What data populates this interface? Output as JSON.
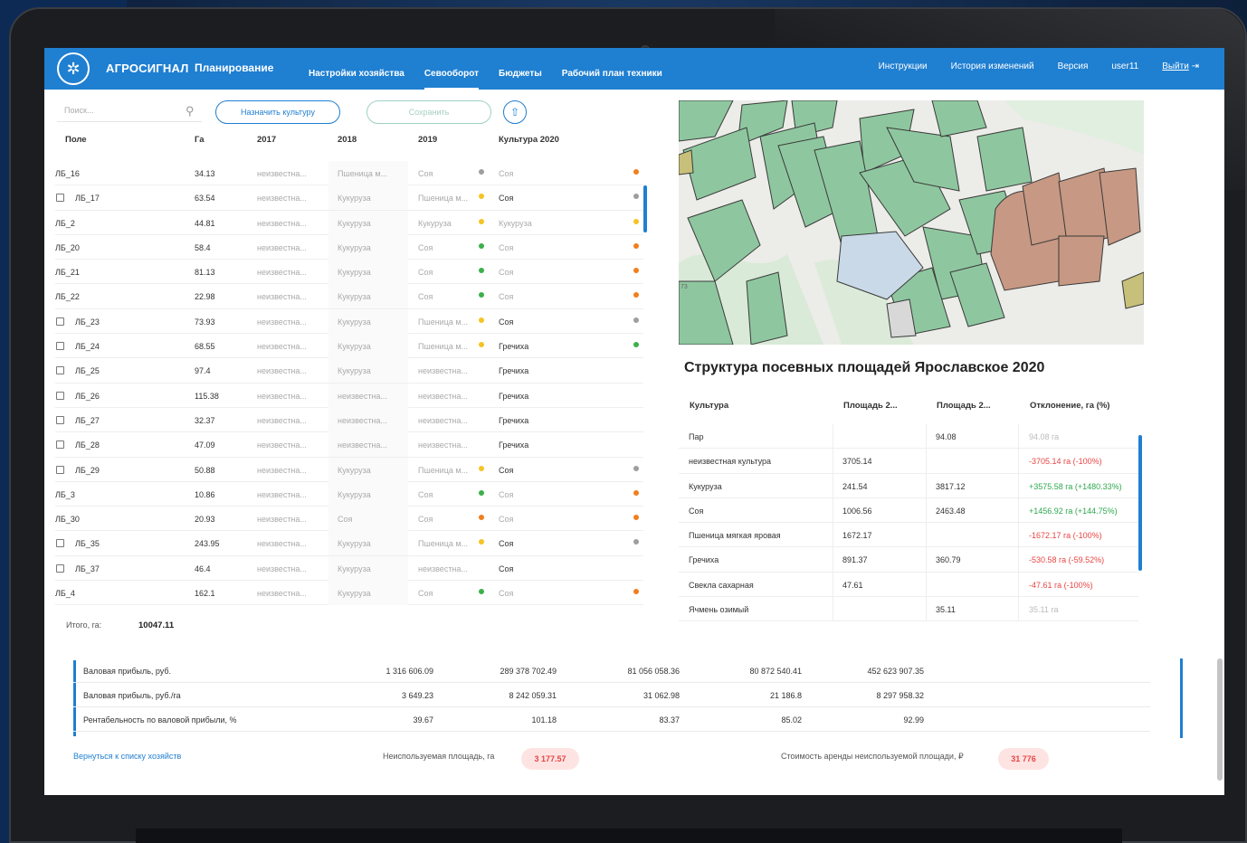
{
  "header": {
    "brand": "АГРОСИГНАЛ",
    "module": "Планирование",
    "tabs": [
      {
        "label": "Настройки хозяйства"
      },
      {
        "label": "Севооборот"
      },
      {
        "label": "Бюджеты"
      },
      {
        "label": "Рабочий план техники"
      }
    ],
    "right": {
      "instructions": "Инструкции",
      "history": "История изменений",
      "version": "Версия",
      "user": "user11",
      "logout": "Выйти"
    }
  },
  "toolbar": {
    "search_placeholder": "Поиск...",
    "assign_label": "Назначить культуру",
    "save_label": "Сохранить"
  },
  "fields_table": {
    "columns": [
      "Поле",
      "Га",
      "2017",
      "2018",
      "2019",
      "Культура 2020"
    ],
    "rows": [
      {
        "field": "ЛБ_16",
        "ha": "34.13",
        "y2017": "неизвестна...",
        "y2018": "Пшеница м...",
        "y2019": "Соя",
        "c2019": "#9e9e9e",
        "crop": "Соя",
        "c2020": "#f07f1e",
        "chk": false,
        "bold": false
      },
      {
        "field": "ЛБ_17",
        "ha": "63.54",
        "y2017": "неизвестна...",
        "y2018": "Кукуруза",
        "y2019": "Пшеница м...",
        "c2019": "#f5c325",
        "crop": "Соя",
        "c2020": "#9e9e9e",
        "chk": true,
        "bold": true
      },
      {
        "field": "ЛБ_2",
        "ha": "44.81",
        "y2017": "неизвестна...",
        "y2018": "Кукуруза",
        "y2019": "Кукуруза",
        "c2019": "#f5c325",
        "crop": "Кукуруза",
        "c2020": "#f5c325",
        "chk": false,
        "bold": false
      },
      {
        "field": "ЛБ_20",
        "ha": "58.4",
        "y2017": "неизвестна...",
        "y2018": "Кукуруза",
        "y2019": "Соя",
        "c2019": "#3cb04a",
        "crop": "Соя",
        "c2020": "#f07f1e",
        "chk": false,
        "bold": false
      },
      {
        "field": "ЛБ_21",
        "ha": "81.13",
        "y2017": "неизвестна...",
        "y2018": "Кукуруза",
        "y2019": "Соя",
        "c2019": "#3cb04a",
        "crop": "Соя",
        "c2020": "#f07f1e",
        "chk": false,
        "bold": false
      },
      {
        "field": "ЛБ_22",
        "ha": "22.98",
        "y2017": "неизвестна...",
        "y2018": "Кукуруза",
        "y2019": "Соя",
        "c2019": "#3cb04a",
        "crop": "Соя",
        "c2020": "#f07f1e",
        "chk": false,
        "bold": false
      },
      {
        "field": "ЛБ_23",
        "ha": "73.93",
        "y2017": "неизвестна...",
        "y2018": "Кукуруза",
        "y2019": "Пшеница м...",
        "c2019": "#f5c325",
        "crop": "Соя",
        "c2020": "#9e9e9e",
        "chk": true,
        "bold": true
      },
      {
        "field": "ЛБ_24",
        "ha": "68.55",
        "y2017": "неизвестна...",
        "y2018": "Кукуруза",
        "y2019": "Пшеница м...",
        "c2019": "#f5c325",
        "crop": "Гречиха",
        "c2020": "#3cb04a",
        "chk": true,
        "bold": true
      },
      {
        "field": "ЛБ_25",
        "ha": "97.4",
        "y2017": "неизвестна...",
        "y2018": "Кукуруза",
        "y2019": "неизвестна...",
        "c2019": "",
        "crop": "Гречиха",
        "c2020": "",
        "chk": true,
        "bold": true
      },
      {
        "field": "ЛБ_26",
        "ha": "115.38",
        "y2017": "неизвестна...",
        "y2018": "неизвестна...",
        "y2019": "неизвестна...",
        "c2019": "",
        "crop": "Гречиха",
        "c2020": "",
        "chk": true,
        "bold": true
      },
      {
        "field": "ЛБ_27",
        "ha": "32.37",
        "y2017": "неизвестна...",
        "y2018": "неизвестна...",
        "y2019": "неизвестна...",
        "c2019": "",
        "crop": "Гречиха",
        "c2020": "",
        "chk": true,
        "bold": true
      },
      {
        "field": "ЛБ_28",
        "ha": "47.09",
        "y2017": "неизвестна...",
        "y2018": "неизвестна...",
        "y2019": "неизвестна...",
        "c2019": "",
        "crop": "Гречиха",
        "c2020": "",
        "chk": true,
        "bold": true
      },
      {
        "field": "ЛБ_29",
        "ha": "50.88",
        "y2017": "неизвестна...",
        "y2018": "Кукуруза",
        "y2019": "Пшеница м...",
        "c2019": "#f5c325",
        "crop": "Соя",
        "c2020": "#9e9e9e",
        "chk": true,
        "bold": true
      },
      {
        "field": "ЛБ_3",
        "ha": "10.86",
        "y2017": "неизвестна...",
        "y2018": "Кукуруза",
        "y2019": "Соя",
        "c2019": "#3cb04a",
        "crop": "Соя",
        "c2020": "#f07f1e",
        "chk": false,
        "bold": false
      },
      {
        "field": "ЛБ_30",
        "ha": "20.93",
        "y2017": "неизвестна...",
        "y2018": "Соя",
        "y2019": "Соя",
        "c2019": "#f07f1e",
        "crop": "Соя",
        "c2020": "#f07f1e",
        "chk": false,
        "bold": false
      },
      {
        "field": "ЛБ_35",
        "ha": "243.95",
        "y2017": "неизвестна...",
        "y2018": "Кукуруза",
        "y2019": "Пшеница м...",
        "c2019": "#f5c325",
        "crop": "Соя",
        "c2020": "#9e9e9e",
        "chk": true,
        "bold": true
      },
      {
        "field": "ЛБ_37",
        "ha": "46.4",
        "y2017": "неизвестна...",
        "y2018": "Кукуруза",
        "y2019": "неизвестна...",
        "c2019": "",
        "crop": "Соя",
        "c2020": "",
        "chk": true,
        "bold": true
      },
      {
        "field": "ЛБ_4",
        "ha": "162.1",
        "y2017": "неизвестна...",
        "y2018": "Кукуруза",
        "y2019": "Соя",
        "c2019": "#3cb04a",
        "crop": "Соя",
        "c2020": "#f07f1e",
        "chk": false,
        "bold": false
      }
    ],
    "total_label": "Итого, га:",
    "total_value": "10047.11"
  },
  "structure": {
    "title": "Структура посевных площадей Ярославское 2020",
    "columns": [
      "Культура",
      "Площадь 2...",
      "Площадь 2...",
      "Отклонение, га (%)"
    ],
    "rows": [
      {
        "crop": "Пар",
        "a1": "",
        "a2": "94.08",
        "dev": "94.08 га",
        "type": "grey"
      },
      {
        "crop": "неизвестная культура",
        "a1": "3705.14",
        "a2": "",
        "dev": "-3705.14 га (-100%)",
        "type": "neg"
      },
      {
        "crop": "Кукуруза",
        "a1": "241.54",
        "a2": "3817.12",
        "dev": "+3575.58 га (+1480.33%)",
        "type": "pos"
      },
      {
        "crop": "Соя",
        "a1": "1006.56",
        "a2": "2463.48",
        "dev": "+1456.92 га (+144.75%)",
        "type": "pos"
      },
      {
        "crop": "Пшеница мягкая яровая",
        "a1": "1672.17",
        "a2": "",
        "dev": "-1672.17 га (-100%)",
        "type": "neg"
      },
      {
        "crop": "Гречиха",
        "a1": "891.37",
        "a2": "360.79",
        "dev": "-530.58 га (-59.52%)",
        "type": "neg"
      },
      {
        "crop": "Свекла сахарная",
        "a1": "47.61",
        "a2": "",
        "dev": "-47.61 га (-100%)",
        "type": "neg"
      },
      {
        "crop": "Ячмень озимый",
        "a1": "",
        "a2": "35.11",
        "dev": "35.11 га",
        "type": "grey"
      }
    ]
  },
  "budget": {
    "rows": [
      {
        "label": "Валовая прибыль, руб.",
        "v": [
          "1 316 606.09",
          "289 378 702.49",
          "81 056 058.36",
          "80 872 540.41",
          "452 623 907.35"
        ]
      },
      {
        "label": "Валовая прибыль, руб./га",
        "v": [
          "3 649.23",
          "8 242 059.31",
          "31 062.98",
          "21 186.8",
          "8 297 958.32"
        ]
      },
      {
        "label": "Рентабельность по валовой прибыли, %",
        "v": [
          "39.67",
          "101.18",
          "83.37",
          "85.02",
          "92.99"
        ]
      }
    ]
  },
  "footer": {
    "back_link": "Вернуться к списку хозяйств",
    "unused_label": "Неиспользуемая площадь, га",
    "unused_value": "3 177.57",
    "rent_label": "Стоимость аренды неиспользуемой площади, ₽",
    "rent_value": "31 776"
  },
  "map": {
    "edge_label": "73"
  }
}
